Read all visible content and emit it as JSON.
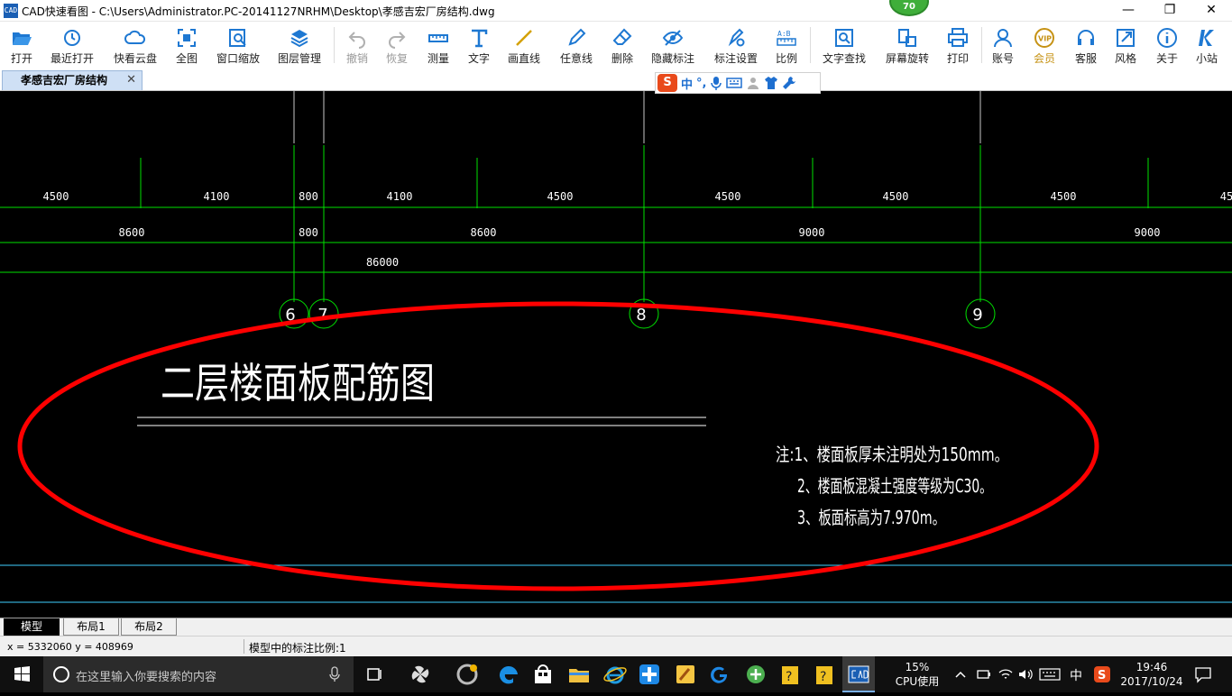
{
  "window": {
    "app_icon_text": "CAD",
    "title": "CAD快速看图 - C:\\Users\\Administrator.PC-20141127NRHM\\Desktop\\孝感吉宏厂房结构.dwg",
    "badge": "70",
    "min_glyph": "—",
    "max_glyph": "❐",
    "close_glyph": "✕"
  },
  "toolbar": {
    "items": [
      {
        "label": "打开",
        "icon": "folder-open-icon"
      },
      {
        "label": "最近打开",
        "icon": "history-icon"
      },
      {
        "label": "快看云盘",
        "icon": "cloud-icon"
      },
      {
        "label": "全图",
        "icon": "fit-all-icon"
      },
      {
        "label": "窗口缩放",
        "icon": "zoom-window-icon"
      },
      {
        "label": "图层管理",
        "icon": "layers-icon"
      },
      {
        "label": "撤销",
        "icon": "undo-icon"
      },
      {
        "label": "恢复",
        "icon": "redo-icon"
      },
      {
        "label": "测量",
        "icon": "measure-icon"
      },
      {
        "label": "文字",
        "icon": "text-icon"
      },
      {
        "label": "画直线",
        "icon": "line-icon"
      },
      {
        "label": "任意线",
        "icon": "pen-icon"
      },
      {
        "label": "删除",
        "icon": "eraser-icon"
      },
      {
        "label": "隐藏标注",
        "icon": "eye-hide-icon"
      },
      {
        "label": "标注设置",
        "icon": "annotation-settings-icon"
      },
      {
        "label": "比例",
        "icon": "scale-icon"
      },
      {
        "label": "文字查找",
        "icon": "text-search-icon"
      },
      {
        "label": "屏幕旋转",
        "icon": "rotate-screen-icon"
      },
      {
        "label": "打印",
        "icon": "print-icon"
      },
      {
        "label": "账号",
        "icon": "account-icon"
      },
      {
        "label": "会员",
        "icon": "vip-icon"
      },
      {
        "label": "客服",
        "icon": "headset-icon"
      },
      {
        "label": "风格",
        "icon": "style-icon"
      },
      {
        "label": "关于",
        "icon": "info-icon"
      },
      {
        "label": "小站",
        "icon": "site-icon"
      }
    ],
    "accent": "#1e78d2",
    "vip_color": "#c69214"
  },
  "tabs": {
    "doc_tab_label": "孝感吉宏厂房结构",
    "close_glyph": "✕"
  },
  "ime_toolbar": {
    "logo": "S",
    "mode": "中",
    "punct": "°,"
  },
  "drawing": {
    "dims_row1": [
      "4500",
      "4100",
      "800",
      "4100",
      "4500",
      "4500",
      "4500",
      "4500",
      "45"
    ],
    "dims_row2": [
      "8600",
      "800",
      "8600",
      "9000",
      "9000"
    ],
    "dims_row3": [
      "86000"
    ],
    "axis_labels": [
      "6",
      "7",
      "8",
      "9"
    ],
    "title": "二层楼面板配筋图",
    "notes": [
      "注:1、楼面板厚未注明处为150mm。",
      "2、楼面板混凝土强度等级为C30。",
      "3、板面标高为7.970m。"
    ],
    "line_color": "#00e000",
    "text_color": "#ffffff",
    "highlight_color": "#ff0000"
  },
  "layout_tabs": [
    "模型",
    "布局1",
    "布局2"
  ],
  "status": {
    "coords": "x = 5332060  y = 408969",
    "scale_text": "模型中的标注比例:1"
  },
  "taskbar": {
    "search_placeholder": "在这里输入你要搜索的内容",
    "cpu_percent": "15%",
    "cpu_label": "CPU使用",
    "ime": "中",
    "time": "19:46",
    "date": "2017/10/24"
  }
}
